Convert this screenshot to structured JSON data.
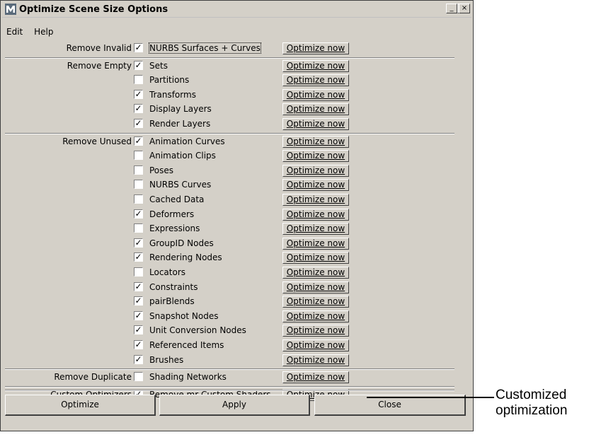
{
  "window": {
    "title": "Optimize Scene Size Options",
    "controls": {
      "minimize": "_",
      "maximize": "□",
      "close": "×"
    }
  },
  "menu": [
    "Edit",
    "Help"
  ],
  "rows": [
    {
      "group": "Remove Invalid",
      "label": "NURBS Surfaces + Curves",
      "checked": true,
      "button": "Optimize now"
    },
    {
      "group": "Remove Empty",
      "label": "Sets",
      "checked": true,
      "button": "Optimize now"
    },
    {
      "group": "",
      "label": "Partitions",
      "checked": false,
      "button": "Optimize now"
    },
    {
      "group": "",
      "label": "Transforms",
      "checked": true,
      "button": "Optimize now"
    },
    {
      "group": "",
      "label": "Display Layers",
      "checked": true,
      "button": "Optimize now"
    },
    {
      "group": "",
      "label": "Render Layers",
      "checked": true,
      "button": "Optimize now"
    },
    {
      "group": "Remove Unused",
      "label": "Animation Curves",
      "checked": true,
      "button": "Optimize now"
    },
    {
      "group": "",
      "label": "Animation Clips",
      "checked": false,
      "button": "Optimize now"
    },
    {
      "group": "",
      "label": "Poses",
      "checked": false,
      "button": "Optimize now"
    },
    {
      "group": "",
      "label": "NURBS Curves",
      "checked": false,
      "button": "Optimize now"
    },
    {
      "group": "",
      "label": "Cached Data",
      "checked": false,
      "button": "Optimize now"
    },
    {
      "group": "",
      "label": "Deformers",
      "checked": true,
      "button": "Optimize now"
    },
    {
      "group": "",
      "label": "Expressions",
      "checked": false,
      "button": "Optimize now"
    },
    {
      "group": "",
      "label": "GroupID Nodes",
      "checked": true,
      "button": "Optimize now"
    },
    {
      "group": "",
      "label": "Rendering Nodes",
      "checked": true,
      "button": "Optimize now"
    },
    {
      "group": "",
      "label": "Locators",
      "checked": false,
      "button": "Optimize now"
    },
    {
      "group": "",
      "label": "Constraints",
      "checked": true,
      "button": "Optimize now"
    },
    {
      "group": "",
      "label": "pairBlends",
      "checked": true,
      "button": "Optimize now"
    },
    {
      "group": "",
      "label": "Snapshot Nodes",
      "checked": true,
      "button": "Optimize now"
    },
    {
      "group": "",
      "label": "Unit Conversion Nodes",
      "checked": true,
      "button": "Optimize now"
    },
    {
      "group": "",
      "label": "Referenced Items",
      "checked": true,
      "button": "Optimize now"
    },
    {
      "group": "",
      "label": "Brushes",
      "checked": true,
      "button": "Optimize now"
    },
    {
      "group": "Remove Duplicate",
      "label": "Shading Networks",
      "checked": false,
      "button": "Optimize now"
    },
    {
      "group": "Custom Optimizers",
      "label": "Remove mr Custom Shaders",
      "checked": true,
      "button": "Optimize now"
    }
  ],
  "buttons": {
    "optimize": "Optimize",
    "apply": "Apply",
    "close": "Close"
  },
  "callout": [
    "Customized",
    "optimization"
  ]
}
